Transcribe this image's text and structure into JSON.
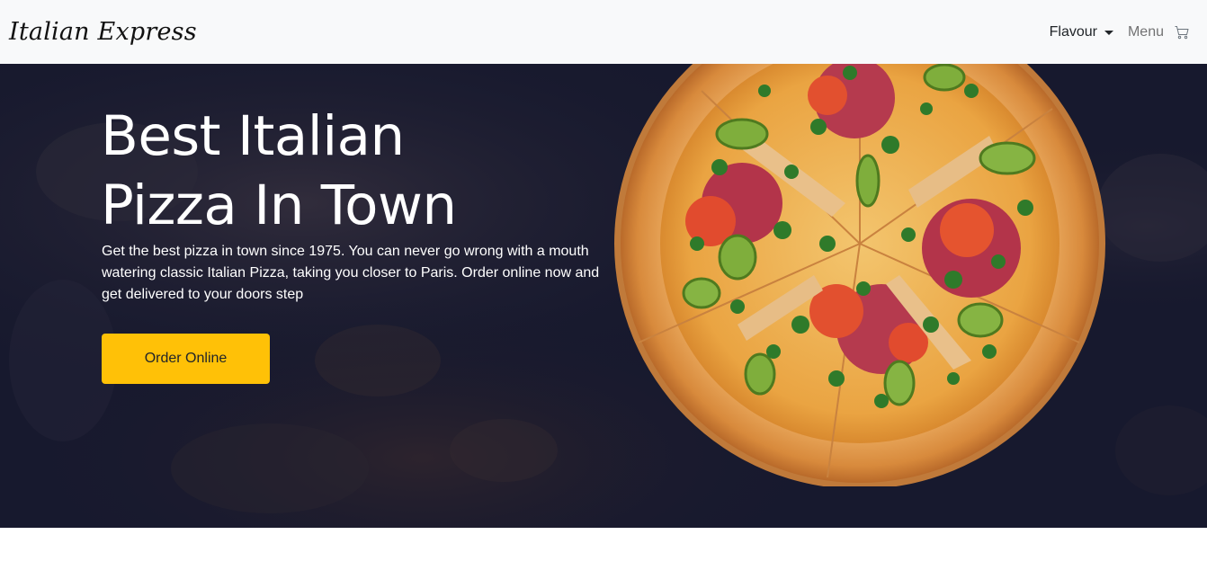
{
  "navbar": {
    "brand": "Italian Express",
    "dropdown_label": "Flavour",
    "menu_label": "Menu",
    "cart_icon": "cart-icon"
  },
  "hero": {
    "title_line1": "Best Italian",
    "title_line2": "Pizza In Town",
    "description": "Get the best pizza in town since 1975. You can never go wrong with a mouth watering classic Italian Pizza, taking you closer to Paris. Order online now and get delivered to your doors step",
    "cta_label": "Order Online",
    "pizza_image": "pizza-image"
  },
  "colors": {
    "navbar_bg": "#f8f9fa",
    "hero_bg": "#16182c",
    "cta": "#ffc107",
    "text_light": "#ffffff",
    "text_dark": "#212529"
  }
}
